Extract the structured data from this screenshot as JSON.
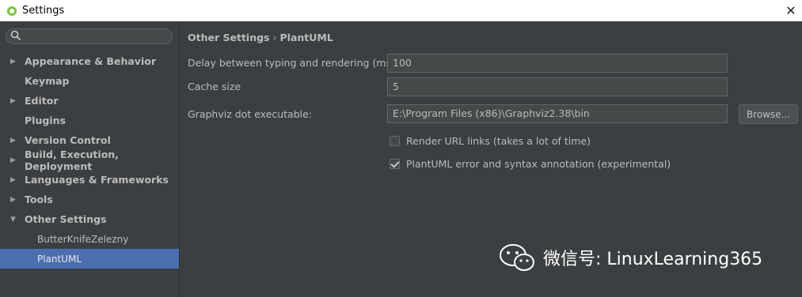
{
  "window": {
    "title": "Settings",
    "close_glyph": "✕"
  },
  "search": {
    "value": "",
    "placeholder": ""
  },
  "sidebar": {
    "items": [
      {
        "label": "Appearance & Behavior",
        "arrow": "▶"
      },
      {
        "label": "Keymap",
        "arrow": ""
      },
      {
        "label": "Editor",
        "arrow": "▶"
      },
      {
        "label": "Plugins",
        "arrow": ""
      },
      {
        "label": "Version Control",
        "arrow": "▶"
      },
      {
        "label": "Build, Execution, Deployment",
        "arrow": "▶"
      },
      {
        "label": "Languages & Frameworks",
        "arrow": "▶"
      },
      {
        "label": "Tools",
        "arrow": "▶"
      },
      {
        "label": "Other Settings",
        "arrow": "▼"
      },
      {
        "label": "ButterKnifeZelezny",
        "arrow": ""
      },
      {
        "label": "PlantUML",
        "arrow": ""
      }
    ]
  },
  "breadcrumb": {
    "parent": "Other Settings",
    "separator": "›",
    "current": "PlantUML"
  },
  "form": {
    "delay_label": "Delay between typing and rendering (ms)",
    "delay_value": "100",
    "cache_label": "Cache size",
    "cache_value": "5",
    "graphviz_label": "Graphviz dot executable:",
    "graphviz_value": "E:\\Program Files (x86)\\Graphviz2.38\\bin",
    "browse_label": "Browse...",
    "render_url_label": "Render URL links (takes a lot of time)",
    "render_url_checked": false,
    "error_annotation_label": "PlantUML error and syntax annotation (experimental)",
    "error_annotation_checked": true
  },
  "watermark": {
    "text": "微信号: LinuxLearning365",
    "icon": "wechat-icon"
  },
  "colors": {
    "selection": "#4b6eaf",
    "background": "#3c3f41",
    "text": "#bbbbbb"
  }
}
